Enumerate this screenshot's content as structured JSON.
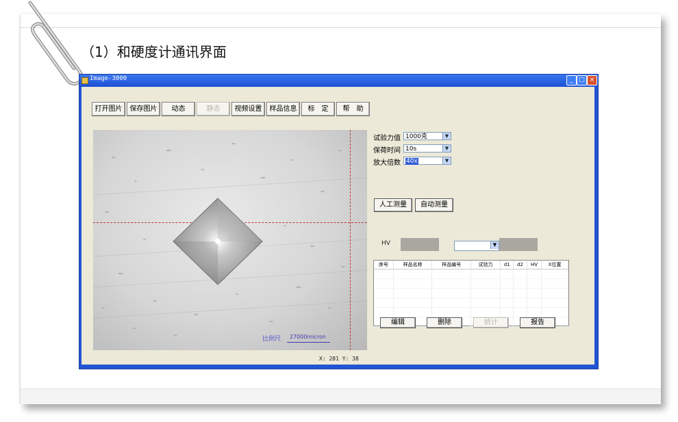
{
  "heading": "（1）和硬度计通讯界面",
  "window": {
    "title": "Image-3000",
    "controls": [
      "minimize-icon",
      "maximize-icon",
      "close-icon"
    ]
  },
  "toolbar": {
    "open": "打开图片",
    "save": "保存图片",
    "live": "动态",
    "freeze": "静态",
    "video_settings": "视频设置",
    "sample_info": "样品信息",
    "calibrate": "标　定",
    "help": "帮　助"
  },
  "params": {
    "force_label": "试验力值",
    "force_value": "1000克",
    "dwell_label": "保荷时间",
    "dwell_value": "10s",
    "mag_label": "放大倍数",
    "mag_value": "40x"
  },
  "measure": {
    "manual": "人工测量",
    "auto": "自动测量",
    "hv_label": "HV"
  },
  "image": {
    "scale_label": "比例尺",
    "scale_value": "27000micron",
    "coords": "X: 281   Y: 38"
  },
  "table": {
    "columns": [
      "序号",
      "样品名称",
      "样品编号",
      "试验力",
      "d1",
      "d2",
      "HV",
      "X位置"
    ]
  },
  "actions": {
    "edit": "编辑",
    "delete": "删除",
    "stats": "统计",
    "report": "报告"
  },
  "colors": {
    "title_bar": "#1d52d6",
    "window_bg": "#ece9d8",
    "crosshair": "#c03434"
  }
}
